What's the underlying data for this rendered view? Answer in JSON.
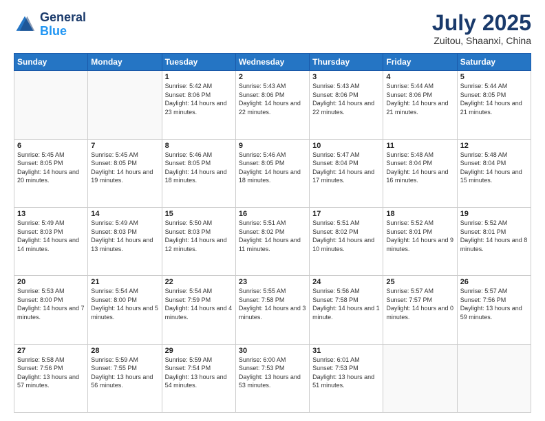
{
  "header": {
    "logo_line1": "General",
    "logo_line2": "Blue",
    "title": "July 2025",
    "subtitle": "Zuitou, Shaanxi, China"
  },
  "weekdays": [
    "Sunday",
    "Monday",
    "Tuesday",
    "Wednesday",
    "Thursday",
    "Friday",
    "Saturday"
  ],
  "weeks": [
    [
      {
        "day": "",
        "info": ""
      },
      {
        "day": "",
        "info": ""
      },
      {
        "day": "1",
        "info": "Sunrise: 5:42 AM\nSunset: 8:06 PM\nDaylight: 14 hours and 23 minutes."
      },
      {
        "day": "2",
        "info": "Sunrise: 5:43 AM\nSunset: 8:06 PM\nDaylight: 14 hours and 22 minutes."
      },
      {
        "day": "3",
        "info": "Sunrise: 5:43 AM\nSunset: 8:06 PM\nDaylight: 14 hours and 22 minutes."
      },
      {
        "day": "4",
        "info": "Sunrise: 5:44 AM\nSunset: 8:06 PM\nDaylight: 14 hours and 21 minutes."
      },
      {
        "day": "5",
        "info": "Sunrise: 5:44 AM\nSunset: 8:05 PM\nDaylight: 14 hours and 21 minutes."
      }
    ],
    [
      {
        "day": "6",
        "info": "Sunrise: 5:45 AM\nSunset: 8:05 PM\nDaylight: 14 hours and 20 minutes."
      },
      {
        "day": "7",
        "info": "Sunrise: 5:45 AM\nSunset: 8:05 PM\nDaylight: 14 hours and 19 minutes."
      },
      {
        "day": "8",
        "info": "Sunrise: 5:46 AM\nSunset: 8:05 PM\nDaylight: 14 hours and 18 minutes."
      },
      {
        "day": "9",
        "info": "Sunrise: 5:46 AM\nSunset: 8:05 PM\nDaylight: 14 hours and 18 minutes."
      },
      {
        "day": "10",
        "info": "Sunrise: 5:47 AM\nSunset: 8:04 PM\nDaylight: 14 hours and 17 minutes."
      },
      {
        "day": "11",
        "info": "Sunrise: 5:48 AM\nSunset: 8:04 PM\nDaylight: 14 hours and 16 minutes."
      },
      {
        "day": "12",
        "info": "Sunrise: 5:48 AM\nSunset: 8:04 PM\nDaylight: 14 hours and 15 minutes."
      }
    ],
    [
      {
        "day": "13",
        "info": "Sunrise: 5:49 AM\nSunset: 8:03 PM\nDaylight: 14 hours and 14 minutes."
      },
      {
        "day": "14",
        "info": "Sunrise: 5:49 AM\nSunset: 8:03 PM\nDaylight: 14 hours and 13 minutes."
      },
      {
        "day": "15",
        "info": "Sunrise: 5:50 AM\nSunset: 8:03 PM\nDaylight: 14 hours and 12 minutes."
      },
      {
        "day": "16",
        "info": "Sunrise: 5:51 AM\nSunset: 8:02 PM\nDaylight: 14 hours and 11 minutes."
      },
      {
        "day": "17",
        "info": "Sunrise: 5:51 AM\nSunset: 8:02 PM\nDaylight: 14 hours and 10 minutes."
      },
      {
        "day": "18",
        "info": "Sunrise: 5:52 AM\nSunset: 8:01 PM\nDaylight: 14 hours and 9 minutes."
      },
      {
        "day": "19",
        "info": "Sunrise: 5:52 AM\nSunset: 8:01 PM\nDaylight: 14 hours and 8 minutes."
      }
    ],
    [
      {
        "day": "20",
        "info": "Sunrise: 5:53 AM\nSunset: 8:00 PM\nDaylight: 14 hours and 7 minutes."
      },
      {
        "day": "21",
        "info": "Sunrise: 5:54 AM\nSunset: 8:00 PM\nDaylight: 14 hours and 5 minutes."
      },
      {
        "day": "22",
        "info": "Sunrise: 5:54 AM\nSunset: 7:59 PM\nDaylight: 14 hours and 4 minutes."
      },
      {
        "day": "23",
        "info": "Sunrise: 5:55 AM\nSunset: 7:58 PM\nDaylight: 14 hours and 3 minutes."
      },
      {
        "day": "24",
        "info": "Sunrise: 5:56 AM\nSunset: 7:58 PM\nDaylight: 14 hours and 1 minute."
      },
      {
        "day": "25",
        "info": "Sunrise: 5:57 AM\nSunset: 7:57 PM\nDaylight: 14 hours and 0 minutes."
      },
      {
        "day": "26",
        "info": "Sunrise: 5:57 AM\nSunset: 7:56 PM\nDaylight: 13 hours and 59 minutes."
      }
    ],
    [
      {
        "day": "27",
        "info": "Sunrise: 5:58 AM\nSunset: 7:56 PM\nDaylight: 13 hours and 57 minutes."
      },
      {
        "day": "28",
        "info": "Sunrise: 5:59 AM\nSunset: 7:55 PM\nDaylight: 13 hours and 56 minutes."
      },
      {
        "day": "29",
        "info": "Sunrise: 5:59 AM\nSunset: 7:54 PM\nDaylight: 13 hours and 54 minutes."
      },
      {
        "day": "30",
        "info": "Sunrise: 6:00 AM\nSunset: 7:53 PM\nDaylight: 13 hours and 53 minutes."
      },
      {
        "day": "31",
        "info": "Sunrise: 6:01 AM\nSunset: 7:53 PM\nDaylight: 13 hours and 51 minutes."
      },
      {
        "day": "",
        "info": ""
      },
      {
        "day": "",
        "info": ""
      }
    ]
  ]
}
